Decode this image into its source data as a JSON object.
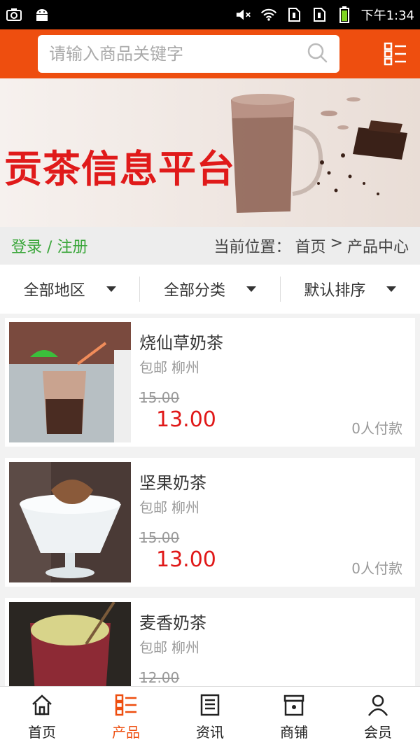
{
  "status_bar": {
    "time": "下午1:34",
    "left_icons": [
      "screenshot-icon",
      "android-icon"
    ],
    "right_icons": [
      "mute-icon",
      "wifi-icon",
      "sim1-icon",
      "sim2-icon",
      "battery-icon"
    ]
  },
  "search": {
    "placeholder": "请输入商品关键字",
    "icon": "search-icon"
  },
  "header": {
    "menu_icon": "category-menu-icon",
    "accent": "#ee4e0f"
  },
  "banner": {
    "title": "贡茶信息平台"
  },
  "breadcrumb": {
    "login_label": "登录",
    "separator": "/",
    "register_label": "注册",
    "location_label": "当前位置：",
    "home": "首页",
    "arrow": ">",
    "current": "产品中心"
  },
  "filters": [
    {
      "label": "全部地区"
    },
    {
      "label": "全部分类"
    },
    {
      "label": "默认排序"
    }
  ],
  "products": [
    {
      "name": "烧仙草奶茶",
      "shipping": "包邮",
      "city": "柳州",
      "old_price": "15.00",
      "price": "13.00",
      "sold": "0人付款"
    },
    {
      "name": "坚果奶茶",
      "shipping": "包邮",
      "city": "柳州",
      "old_price": "15.00",
      "price": "13.00",
      "sold": "0人付款"
    },
    {
      "name": "麦香奶茶",
      "shipping": "包邮",
      "city": "柳州",
      "old_price": "12.00",
      "price": "",
      "sold": ""
    }
  ],
  "bottom_nav": [
    {
      "label": "首页",
      "icon": "home-icon"
    },
    {
      "label": "产品",
      "icon": "products-icon"
    },
    {
      "label": "资讯",
      "icon": "news-icon"
    },
    {
      "label": "商铺",
      "icon": "shop-icon"
    },
    {
      "label": "会员",
      "icon": "member-icon"
    }
  ],
  "colors": {
    "accent": "#ee4e0f",
    "price": "#e01818",
    "login": "#3aa63a",
    "banner_title": "#e01a1a"
  }
}
